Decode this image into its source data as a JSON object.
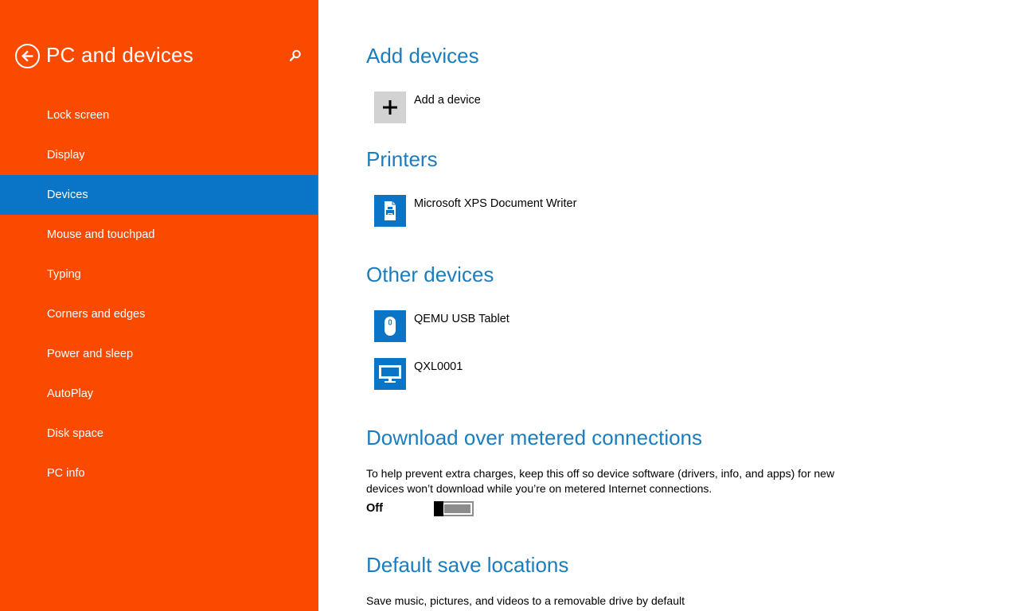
{
  "sidebar": {
    "title": "PC and devices",
    "back_icon": "back-arrow-icon",
    "search_icon": "search-icon",
    "background_color": "#fa4a00",
    "selected_color": "#0a74c6",
    "items": [
      {
        "label": "Lock screen",
        "selected": false
      },
      {
        "label": "Display",
        "selected": false
      },
      {
        "label": "Devices",
        "selected": true
      },
      {
        "label": "Mouse and touchpad",
        "selected": false
      },
      {
        "label": "Typing",
        "selected": false
      },
      {
        "label": "Corners and edges",
        "selected": false
      },
      {
        "label": "Power and sleep",
        "selected": false
      },
      {
        "label": "AutoPlay",
        "selected": false
      },
      {
        "label": "Disk space",
        "selected": false
      },
      {
        "label": "PC info",
        "selected": false
      }
    ]
  },
  "main": {
    "accent_color": "#1b7dbd",
    "add_devices": {
      "title": "Add devices",
      "add_label": "Add a device",
      "icon": "plus-icon"
    },
    "printers": {
      "title": "Printers",
      "items": [
        {
          "label": "Microsoft XPS Document Writer",
          "icon": "printer-icon"
        }
      ]
    },
    "other_devices": {
      "title": "Other devices",
      "items": [
        {
          "label": "QEMU USB Tablet",
          "icon": "mouse-icon"
        },
        {
          "label": "QXL0001",
          "icon": "monitor-icon"
        }
      ]
    },
    "metered": {
      "title": "Download over metered connections",
      "description": "To help prevent extra charges, keep this off so device software (drivers, info, and apps) for new devices won’t download while you’re on metered Internet connections.",
      "toggle_state": "Off",
      "toggle_on": false
    },
    "save_locations": {
      "title": "Default save locations",
      "description": "Save music, pictures, and videos to a removable drive by default"
    }
  }
}
